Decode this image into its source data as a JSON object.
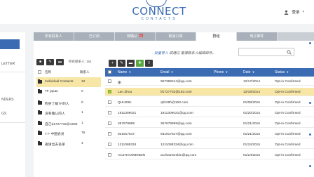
{
  "header": {
    "logo_title": "CONNECT",
    "logo_sub": "CONTACTS",
    "user_name": "登录"
  },
  "nav": {
    "items": [
      {
        "label": ""
      },
      {
        "label": "LETTER"
      },
      {
        "label": "NDERS"
      },
      {
        "label": "GS"
      }
    ]
  },
  "tabs": [
    {
      "label": "所有联系人",
      "badge": "",
      "active": false
    },
    {
      "label": "已订阅",
      "badge": "",
      "active": false
    },
    {
      "label": "待确认",
      "badge": "6",
      "active": false
    },
    {
      "label": "取消订阅",
      "badge": "",
      "active": false
    },
    {
      "label": "群组",
      "badge": "",
      "active": true
    },
    {
      "label": "电子邮件",
      "badge": "",
      "active": false
    }
  ],
  "left_list": {
    "count_label": "所有联系人: 154",
    "header": {
      "name": "名称",
      "count": "联系人"
    },
    "rows": [
      {
        "name": "Individual Contacts",
        "count": "12",
        "selected": true
      },
      {
        "name": "TF japan",
        "count": "0",
        "selected": false
      },
      {
        "name": "购买了解TF的人",
        "count": "0",
        "selected": false
      },
      {
        "name": "没有确认的人",
        "count": "1",
        "selected": false
      },
      {
        "name": "自己d1727732@1630",
        "count": "1",
        "selected": false
      },
      {
        "name": "T F 中国会员",
        "count": "76",
        "selected": false
      },
      {
        "name": "邀请出去名单",
        "count": "4",
        "selected": false
      }
    ]
  },
  "import": {
    "link": "批量导入",
    "text": "或通过 邀请联系人编辑邮件。"
  },
  "search": {
    "placeholder": ""
  },
  "table": {
    "headers": {
      "name": "Name",
      "email": "Email",
      "phone": "Phone",
      "date": "Date",
      "status": "Status"
    },
    "rows": [
      {
        "name": "谢",
        "email": "957386214@qq.com",
        "phone": "",
        "date": "12/17/2014",
        "status": "Opt-in Confirmed",
        "checked": false,
        "highlight": false
      },
      {
        "name": "Lan Zhou",
        "email": "tf1727732@163.com",
        "phone": "",
        "date": "12/18/2014",
        "status": "Opt-in Confirmed",
        "checked": true,
        "highlight": true
      },
      {
        "name": "QHH28H",
        "email": "qhh28h@163.com",
        "phone": "",
        "date": "01/08/2015",
        "status": "Opt-in Confirmed",
        "checked": false,
        "highlight": false
      },
      {
        "name": "1911309021",
        "email": "1911309021@qq.com",
        "phone": "",
        "date": "01/20/2015",
        "status": "Opt-in Confirmed",
        "checked": false,
        "highlight": false
      },
      {
        "name": "357679999",
        "email": "357679999@qq.com",
        "phone": "",
        "date": "01/21/2015",
        "status": "Opt-in Confirmed",
        "checked": false,
        "highlight": false
      },
      {
        "name": "931917547",
        "email": "931917547@qq.com",
        "phone": "",
        "date": "01/21/2015",
        "status": "Opt-in Confirmed",
        "checked": false,
        "highlight": false
      },
      {
        "name": "1211088334",
        "email": "1211088334@qq.com",
        "phone": "",
        "date": "01/24/2015",
        "status": "Opt-in Confirmed",
        "checked": false,
        "highlight": false
      },
      {
        "name": "ACZHAOWENBIN",
        "email": "aczhaowenbin@qq.com",
        "phone": "",
        "date": "01/24/2015",
        "status": "Opt-in Confirmed",
        "checked": false,
        "highlight": false
      }
    ]
  },
  "colors": {
    "accent": "#3b6cb3",
    "highlight": "#f7e6a6",
    "badge": "#d9534f",
    "check": "#9bcc3a"
  }
}
